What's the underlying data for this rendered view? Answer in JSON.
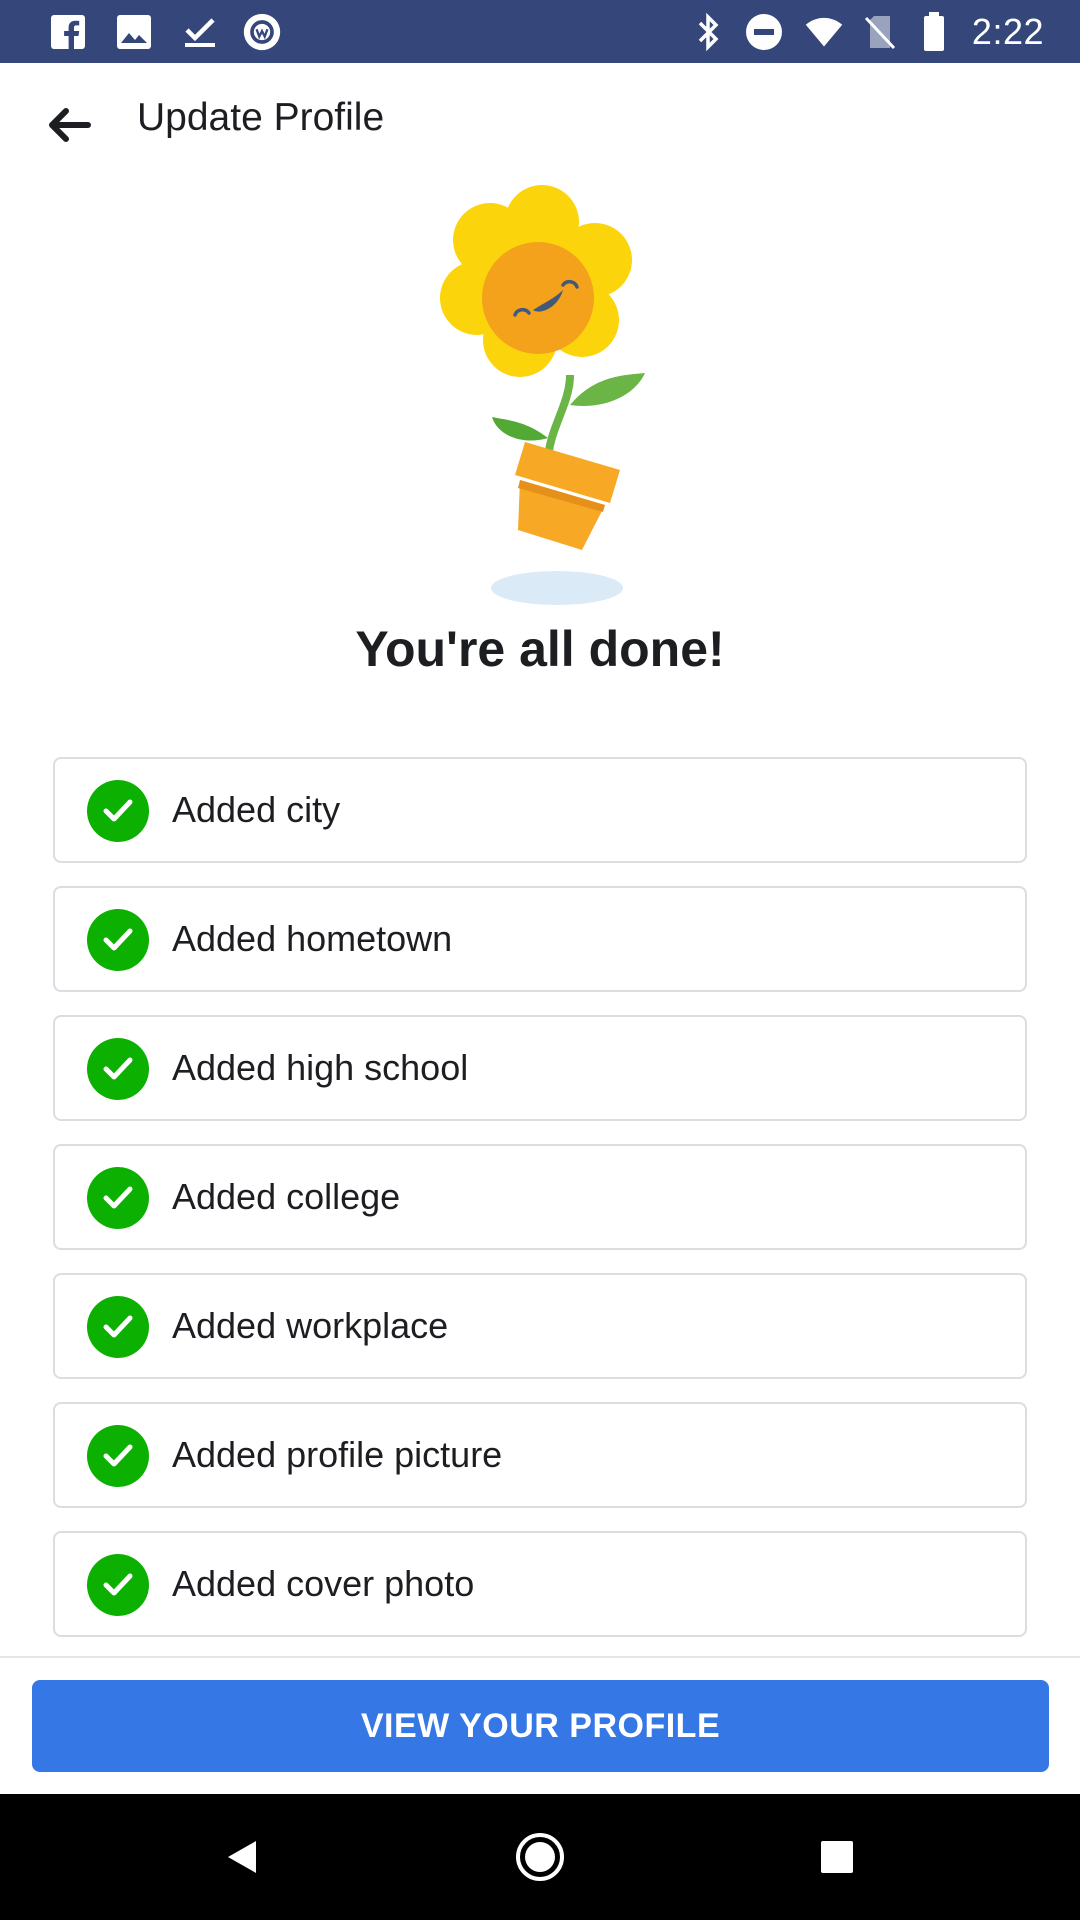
{
  "status_bar": {
    "time": "2:22",
    "left_icons": [
      "facebook-icon",
      "image-icon",
      "download-done-icon",
      "workplace-icon"
    ],
    "right_icons": [
      "bluetooth-icon",
      "do-not-disturb-icon",
      "wifi-icon",
      "no-sim-icon",
      "battery-icon"
    ]
  },
  "app_bar": {
    "title": "Update Profile",
    "back_icon": "arrow-left-icon"
  },
  "main": {
    "heading": "You're all done!",
    "items": [
      {
        "label": "Added city"
      },
      {
        "label": "Added hometown"
      },
      {
        "label": "Added high school"
      },
      {
        "label": "Added college"
      },
      {
        "label": "Added workplace"
      },
      {
        "label": "Added profile picture"
      },
      {
        "label": "Added cover photo"
      }
    ]
  },
  "footer": {
    "button_label": "VIEW YOUR PROFILE"
  },
  "colors": {
    "status_bar": "#35477a",
    "check": "#0bb000",
    "primary": "#3578e5"
  },
  "nav_bar": {
    "icons": [
      "back-triangle-icon",
      "home-circle-icon",
      "recents-square-icon"
    ]
  }
}
